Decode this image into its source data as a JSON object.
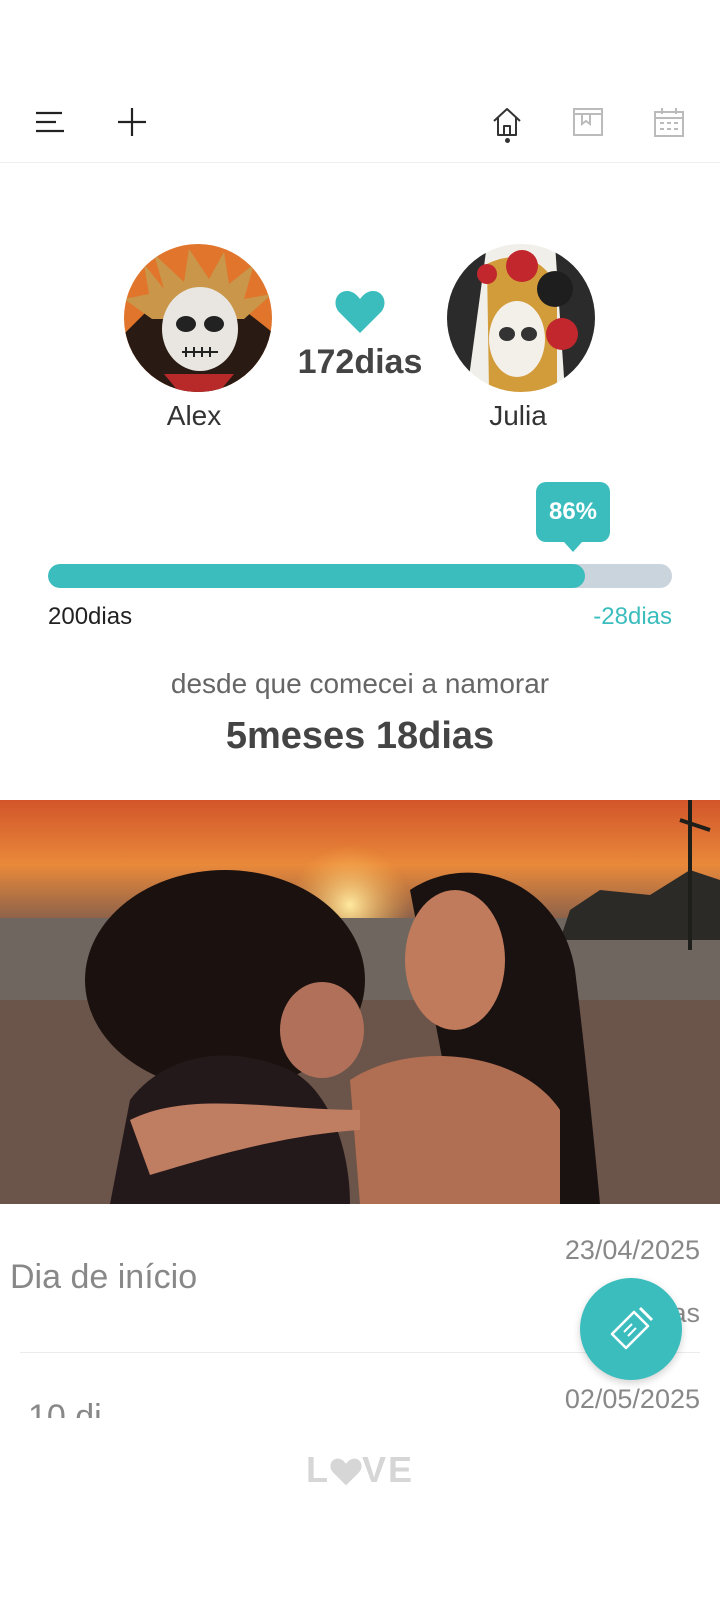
{
  "topbar": {
    "menu_icon": "menu-icon",
    "add_icon": "plus-icon",
    "home_icon": "home-icon",
    "album_icon": "bookmark-icon",
    "calendar_icon": "calendar-icon"
  },
  "couple": {
    "left_name": "Alex",
    "right_name": "Julia",
    "days_together": "172dias"
  },
  "progress": {
    "percent_label": "86%",
    "percent": 0.86,
    "goal_label": "200dias",
    "remaining_label": "-28dias"
  },
  "since": {
    "caption": "desde que comecei a namorar",
    "duration": "5meses 18dias"
  },
  "list": {
    "row1_label": "Dia de início",
    "row1_date": "23/04/2025",
    "row1_sub": "as",
    "row2_date": "02/05/2025",
    "row2_label_partial": "10 di"
  },
  "footer": {
    "brand_l": "L",
    "brand_ve": "VE"
  },
  "colors": {
    "accent": "#3bbdbe",
    "track": "#c9d4dc"
  }
}
